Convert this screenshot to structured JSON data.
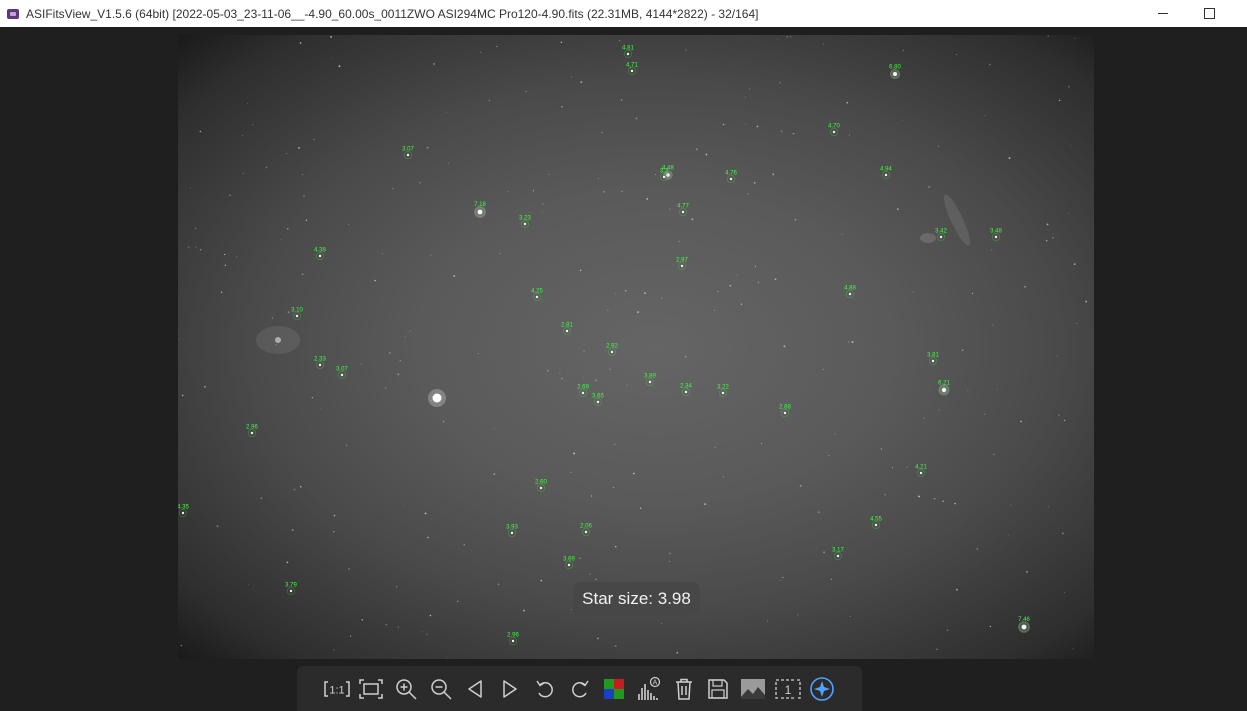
{
  "window": {
    "title": "ASIFitsView_V1.5.6 (64bit) [2022-05-03_23-11-06__-4.90_60.00s_0011ZWO ASI294MC Pro120-4.90.fits (22.31MB, 4144*2822) - 32/164]",
    "minimize_glyph": "—",
    "maximize_glyph": "☐"
  },
  "viewer": {
    "toast_text": "Star size: 3.98",
    "stars": [
      {
        "label": "4.81"
      },
      {
        "label": "4.71"
      },
      {
        "label": "6.80"
      },
      {
        "label": "4.70"
      },
      {
        "label": "3.07"
      },
      {
        "label": "4.48"
      },
      {
        "label": "3.2"
      },
      {
        "label": "4.76"
      },
      {
        "label": "4.94"
      },
      {
        "label": "7.18"
      },
      {
        "label": "3.23"
      },
      {
        "label": "4.77"
      },
      {
        "label": "3.42"
      },
      {
        "label": "3.48"
      },
      {
        "label": "4.38"
      },
      {
        "label": "2.97"
      },
      {
        "label": "4.25"
      },
      {
        "label": "4.88"
      },
      {
        "label": "3.10"
      },
      {
        "label": "2.81"
      },
      {
        "label": "2.92"
      },
      {
        "label": "3.81"
      },
      {
        "label": "2.33"
      },
      {
        "label": "3.07"
      },
      {
        "label": "3.89"
      },
      {
        "label": "6.21"
      },
      {
        "label": "2.69"
      },
      {
        "label": "2.34"
      },
      {
        "label": "3.22"
      },
      {
        "label": "3.65"
      },
      {
        "label": "2.88"
      },
      {
        "label": "2.96"
      },
      {
        "label": "4.21"
      },
      {
        "label": "2.60"
      },
      {
        "label": "4.35"
      },
      {
        "label": "4.55"
      },
      {
        "label": "3.93"
      },
      {
        "label": "2.06"
      },
      {
        "label": "3.17"
      },
      {
        "label": "3.69"
      },
      {
        "label": "3.79"
      },
      {
        "label": "7.46"
      },
      {
        "label": "2.96"
      }
    ]
  },
  "toolbar": {
    "buttons": [
      {
        "name": "actual-size-button",
        "icon": "actual-size-icon",
        "text": "1:1"
      },
      {
        "name": "fit-window-button",
        "icon": "fit-window-icon"
      },
      {
        "name": "zoom-in-button",
        "icon": "zoom-in-icon"
      },
      {
        "name": "zoom-out-button",
        "icon": "zoom-out-icon"
      },
      {
        "name": "previous-image-button",
        "icon": "previous-icon"
      },
      {
        "name": "next-image-button",
        "icon": "next-icon"
      },
      {
        "name": "rotate-left-button",
        "icon": "rotate-left-icon"
      },
      {
        "name": "rotate-right-button",
        "icon": "rotate-right-icon"
      },
      {
        "name": "color-channels-button",
        "icon": "bayer-channels-icon"
      },
      {
        "name": "auto-stretch-button",
        "icon": "histogram-auto-icon"
      },
      {
        "name": "delete-button",
        "icon": "trash-icon"
      },
      {
        "name": "save-button",
        "icon": "save-icon"
      },
      {
        "name": "image-info-button",
        "icon": "image-icon"
      },
      {
        "name": "frame-split-button",
        "icon": "frame-number-icon",
        "text": "1"
      },
      {
        "name": "star-detect-button",
        "icon": "star-detect-icon"
      }
    ],
    "active_color": "#4da3ff"
  }
}
